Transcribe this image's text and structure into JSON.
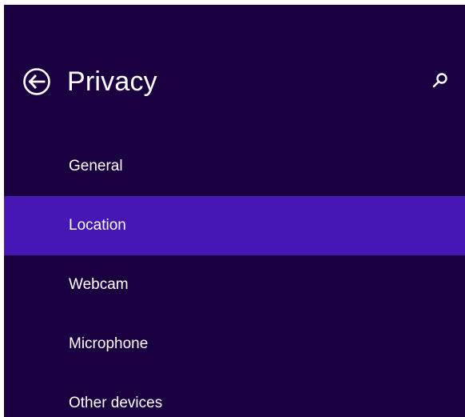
{
  "header": {
    "title": "Privacy",
    "back_icon": "back-arrow-circle-icon",
    "search_icon": "search-icon"
  },
  "nav": {
    "selected_index": 1,
    "items": [
      {
        "label": "General"
      },
      {
        "label": "Location"
      },
      {
        "label": "Webcam"
      },
      {
        "label": "Microphone"
      },
      {
        "label": "Other devices"
      }
    ]
  },
  "colors": {
    "background": "#1a0040",
    "selected": "#4617b4",
    "text": "#ffffff"
  }
}
